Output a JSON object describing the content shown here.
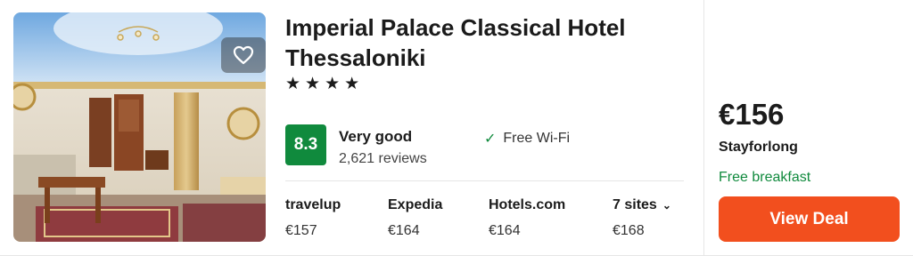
{
  "hotel": {
    "name": "Imperial Palace Classical Hotel Thessaloniki",
    "stars": "★★★★",
    "star_count": 4,
    "rating": {
      "score": "8.3",
      "label": "Very good",
      "reviews": "2,621 reviews",
      "color": "#108a3d"
    },
    "amenity": "Free Wi-Fi",
    "favorite_icon": "heart-outline-icon"
  },
  "providers": [
    {
      "name": "travelup",
      "price": "€157"
    },
    {
      "name": "Expedia",
      "price": "€164"
    },
    {
      "name": "Hotels.com",
      "price": "€164"
    },
    {
      "name": "7 sites",
      "price": "€168"
    }
  ],
  "deal": {
    "price": "€156",
    "site": "Stayforlong",
    "perk": "Free breakfast",
    "button_label": "View Deal",
    "button_color": "#f24f1e"
  }
}
